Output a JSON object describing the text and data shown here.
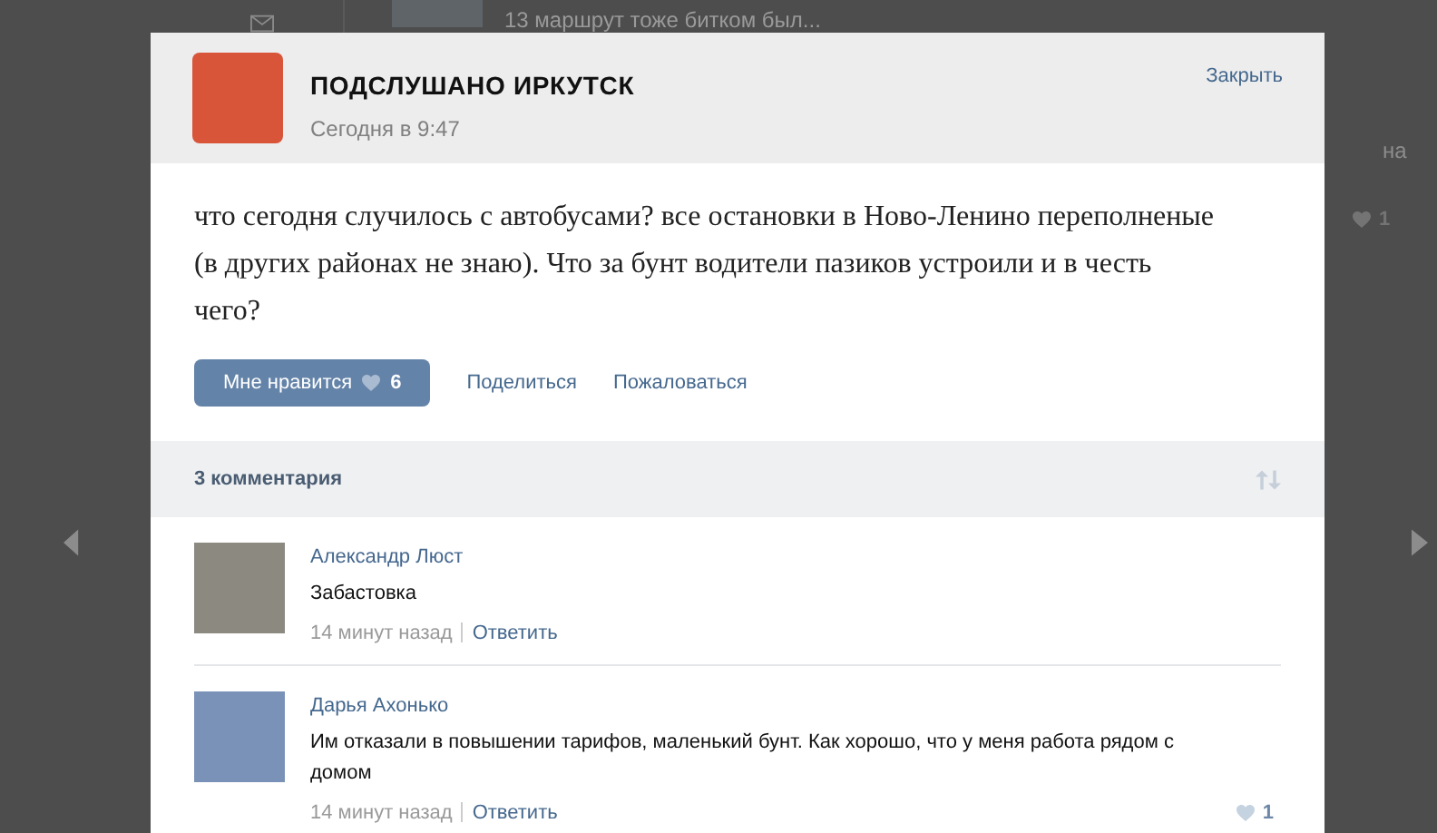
{
  "background": {
    "feed_text": "13 маршрут тоже битком был...",
    "side_fragment": "на",
    "side_likes": "1"
  },
  "post": {
    "group_name": "ПОДСЛУШАНО ИРКУТСК",
    "time": "Сегодня в 9:47",
    "close": "Закрыть",
    "text": "что сегодня случилось с автобусами? все остановки в Ново-Ленино переполненые (в других районах не знаю). Что за бунт водители пазиков устроили и в честь чего?",
    "like_label": "Мне нравится",
    "like_count": "6",
    "liked": false,
    "share": "Поделиться",
    "report": "Пожаловаться"
  },
  "comments": {
    "count_label": "3 комментария",
    "items": [
      {
        "author": "Александр Люст",
        "text": "Забастовка",
        "time": "14 минут назад",
        "reply": "Ответить"
      },
      {
        "author": "Дарья Ахонько",
        "text": "Им отказали в повышении тарифов, маленький бунт. Как хорошо, что у меня работа рядом с домом",
        "time": "14 минут назад",
        "reply": "Ответить",
        "likes": "1"
      }
    ]
  }
}
